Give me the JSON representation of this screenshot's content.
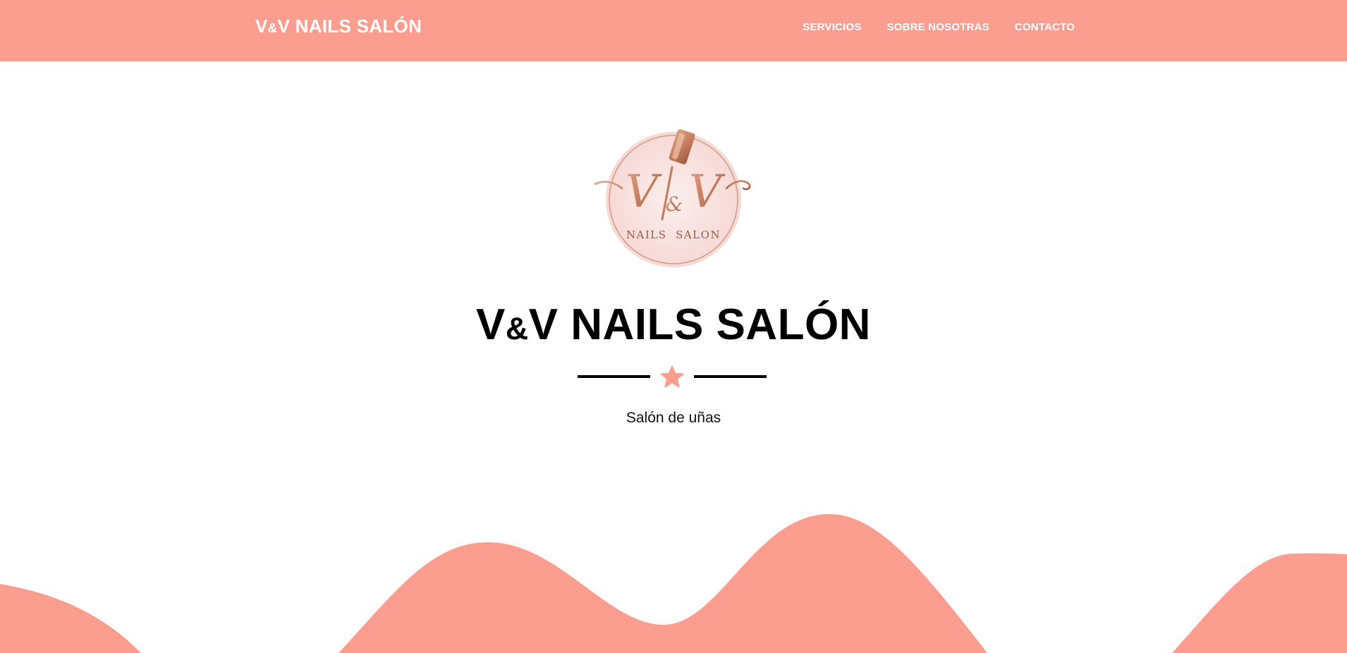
{
  "nav": {
    "brand": {
      "prefix": "V",
      "amp": "&",
      "suffix": "V NAILS SALÓN"
    },
    "links": [
      "SERVICIOS",
      "SOBRE NOSOTRAS",
      "CONTACTO"
    ]
  },
  "hero": {
    "logo": {
      "monogram": {
        "left": "V",
        "amp": "&",
        "right": "V"
      },
      "caption": "NAILS  SALON"
    },
    "title": {
      "prefix": "V",
      "amp": "&",
      "suffix": "V NAILS SALÓN"
    },
    "subtitle": "Salón de uñas",
    "divider_icon": "star-icon"
  },
  "colors": {
    "accent": "#fc9e8f",
    "logo_copper": "#c98a6e",
    "logo_blush": "#f8e1df",
    "text": "#000000",
    "nav_text": "#ffffff"
  }
}
